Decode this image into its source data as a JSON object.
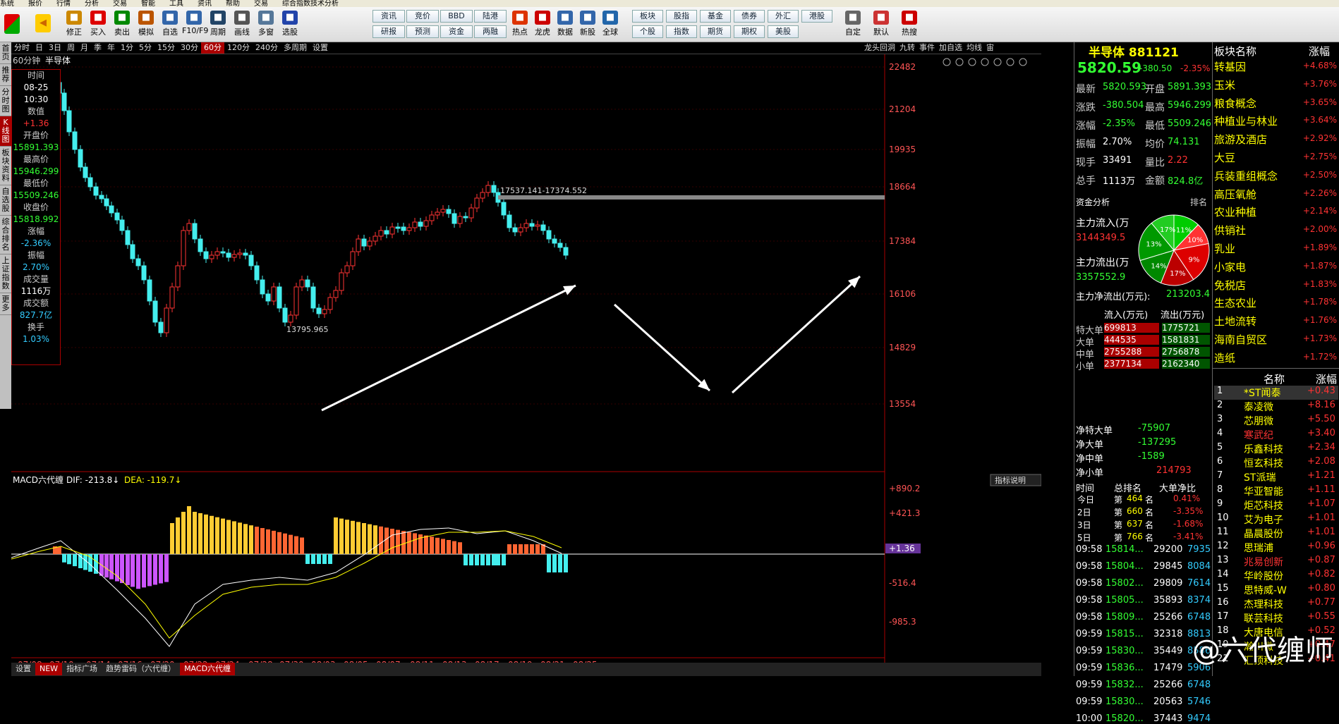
{
  "menu": [
    "系统",
    "报价",
    "行情",
    "分析",
    "交易",
    "智能",
    "工具",
    "资讯",
    "帮助",
    "交易",
    "综合指数技术分析"
  ],
  "toolbar": {
    "big": [
      {
        "label": "修正",
        "icon": "up-icon",
        "color": "#c80"
      },
      {
        "label": "买入",
        "icon": "buy-icon",
        "color": "#d00"
      },
      {
        "label": "卖出",
        "icon": "sell-icon",
        "color": "#080"
      },
      {
        "label": "模拟",
        "icon": "hammer-icon",
        "color": "#b50"
      },
      {
        "label": "自选",
        "icon": "star-icon",
        "color": "#36a"
      },
      {
        "label": "F10/F9",
        "icon": "f10-icon",
        "color": "#36a"
      },
      {
        "label": "周期",
        "icon": "clock-icon",
        "color": "#246"
      },
      {
        "label": "画线",
        "icon": "pencil-icon",
        "color": "#555"
      },
      {
        "label": "多窗",
        "icon": "window-icon",
        "color": "#579"
      },
      {
        "label": "选股",
        "icon": "search-icon",
        "color": "#24a"
      }
    ],
    "small_rows": [
      [
        "资讯",
        "竞价",
        "BBD",
        "陆港"
      ],
      [
        "研报",
        "预测",
        "资金",
        "两融"
      ]
    ],
    "mid": [
      {
        "label": "热点",
        "icon": "fire-icon",
        "color": "#d30"
      },
      {
        "label": "龙虎",
        "icon": "dragon-icon",
        "color": "#c00"
      },
      {
        "label": "数据",
        "icon": "pe-icon",
        "color": "#36a"
      },
      {
        "label": "新股",
        "icon": "doc-icon",
        "color": "#36a"
      },
      {
        "label": "全球",
        "icon": "globe-icon",
        "color": "#26a"
      }
    ],
    "small_rows2": [
      [
        "板块",
        "股指",
        "基金",
        "债券",
        "外汇",
        "港股"
      ],
      [
        "个股",
        "指数",
        "期货",
        "期权",
        "美股"
      ]
    ],
    "right": [
      {
        "label": "自定",
        "icon": "custom-icon",
        "color": "#666"
      },
      {
        "label": "默认",
        "icon": "home-icon",
        "color": "#c33"
      },
      {
        "label": "热搜",
        "icon": "hot-icon",
        "color": "#c00"
      }
    ]
  },
  "left_tabs": [
    "首页",
    "推荐",
    "分时图",
    "K线图",
    "板块资料",
    "自选股",
    "综合排名",
    "上证指数",
    "更多"
  ],
  "periods": [
    "分时",
    "日",
    "3日",
    "周",
    "月",
    "季",
    "年",
    "1分",
    "5分",
    "15分",
    "30分",
    "60分",
    "120分",
    "240分",
    "多周期",
    "设置"
  ],
  "period_selected": "60分",
  "right_tabs": [
    "龙头回洞",
    "九转",
    "事件",
    "加自选",
    "均线",
    "宙"
  ],
  "chart_label": "60分钟",
  "chart_name": "半导体",
  "info": [
    {
      "k": "时间",
      "v": "08-25"
    },
    {
      "k": "",
      "v": "10:30"
    },
    {
      "k": "数值",
      "v": "+1.36"
    },
    {
      "k": "开盘价",
      "v": "15891.393"
    },
    {
      "k": "最高价",
      "v": "15946.299"
    },
    {
      "k": "最低价",
      "v": "15509.246"
    },
    {
      "k": "收盘价",
      "v": "15818.992"
    },
    {
      "k": "涨幅",
      "v": "-2.36%"
    },
    {
      "k": "振幅",
      "v": "2.70%"
    },
    {
      "k": "成交量",
      "v": "1116万"
    },
    {
      "k": "成交额",
      "v": "827.7亿"
    },
    {
      "k": "换手",
      "v": "1.03%"
    }
  ],
  "price_axis": [
    "22482",
    "21204",
    "19935",
    "18664",
    "17384",
    "16106",
    "14829",
    "13554"
  ],
  "macd_axis": [
    "+890.2",
    "+421.3",
    "+1.36",
    "-516.4",
    "-985.3"
  ],
  "date_axis": [
    "07/08",
    "07/10",
    "07/14",
    "07/16",
    "07/20",
    "07/22",
    "07/24",
    "07/28",
    "07/30",
    "08/03",
    "08/05",
    "08/07",
    "08/11",
    "08/13",
    "08/17",
    "08/19",
    "08/21",
    "08/25"
  ],
  "annot_high": "17537.141-17374.552",
  "annot_low": "13795.965",
  "macd_label": "MACD六代缠",
  "macd_dif": "DIF: -213.8↓",
  "macd_dea": "DEA: -119.7↓",
  "indicator_btn": "指标说明",
  "status_tabs": [
    "设置",
    "NEW",
    "指标广场",
    "趋势雷码（六代缠）",
    "MACD六代缠"
  ],
  "quote": {
    "title": "半导体 881121",
    "price": "5820.59",
    "change": "-380.50",
    "pct": "-2.35%",
    "rows": [
      [
        "最新",
        "5820.593",
        "开盘",
        "5891.393"
      ],
      [
        "涨跌",
        "-380.504",
        "最高",
        "5946.299"
      ],
      [
        "涨幅",
        "-2.35%",
        "最低",
        "5509.246"
      ],
      [
        "振幅",
        "2.70%",
        "均价",
        "74.131"
      ],
      [
        "现手",
        "33491",
        "量比",
        "2.22"
      ],
      [
        "总手",
        "1113万",
        "金额",
        "824.8亿"
      ]
    ]
  },
  "fund": {
    "title": "资金分析",
    "rank": "排名",
    "inflow_label": "主力流入(万",
    "inflow": "3144349.5",
    "outflow_label": "主力流出(万",
    "outflow": "3357552.9",
    "net_label": "主力净流出(万元):",
    "net": "213203.4",
    "pie": [
      {
        "v": 11,
        "c": "#0c0"
      },
      {
        "v": 9,
        "c": "#f33"
      },
      {
        "v": 17,
        "c": "#d00"
      },
      {
        "v": 14,
        "c": "#b00"
      },
      {
        "v": 13,
        "c": "#080"
      },
      {
        "v": 17,
        "c": "#090"
      },
      {
        "v": 10,
        "c": "#2c2"
      }
    ],
    "pie_labels": [
      "11%",
      "10%",
      "9%",
      "17%",
      "14%",
      "13%",
      "17%",
      "10%"
    ],
    "flow_head": [
      "流入(万元)",
      "流出(万元)"
    ],
    "flows": [
      [
        "特大单",
        "699813",
        "1775721"
      ],
      [
        "大单",
        "444535",
        "1581831"
      ],
      [
        "中单",
        "2755288",
        "2756878"
      ],
      [
        "小单",
        "2377134",
        "2162340"
      ]
    ],
    "nets": [
      [
        "净特大单",
        "-75907"
      ],
      [
        "净大单",
        "-137295"
      ],
      [
        "净中单",
        "-1589"
      ],
      [
        "净小单",
        "214793"
      ]
    ],
    "rank_head": [
      "时间",
      "总排名",
      "大单净比"
    ],
    "ranks": [
      [
        "今日",
        "第",
        "464",
        "名",
        "0.41%"
      ],
      [
        "2日",
        "第",
        "660",
        "名",
        "-3.35%"
      ],
      [
        "3日",
        "第",
        "637",
        "名",
        "-1.68%"
      ],
      [
        "5日",
        "第",
        "766",
        "名",
        "-3.41%"
      ]
    ],
    "ticks": [
      [
        "09:58",
        "15814...",
        "29200",
        "7935"
      ],
      [
        "09:58",
        "15804...",
        "29845",
        "8084"
      ],
      [
        "09:58",
        "15802...",
        "29809",
        "7614"
      ],
      [
        "09:58",
        "15805...",
        "35893",
        "8374"
      ],
      [
        "09:58",
        "15809...",
        "25266",
        "6748"
      ],
      [
        "09:59",
        "15815...",
        "32318",
        "8813"
      ],
      [
        "09:59",
        "15830...",
        "35449",
        "8586"
      ],
      [
        "09:59",
        "15836...",
        "17479",
        "5906"
      ],
      [
        "09:59",
        "15832...",
        "25266",
        "6748"
      ],
      [
        "09:59",
        "15830...",
        "20563",
        "5746"
      ],
      [
        "10:00",
        "15820...",
        "37443",
        "9474"
      ]
    ]
  },
  "sector_head": [
    "板块名称",
    "涨幅"
  ],
  "sectors": [
    [
      "转基因",
      "+4.68%"
    ],
    [
      "玉米",
      "+3.76%"
    ],
    [
      "粮食概念",
      "+3.65%"
    ],
    [
      "种植业与林业",
      "+3.64%"
    ],
    [
      "旅游及酒店",
      "+2.92%"
    ],
    [
      "大豆",
      "+2.75%"
    ],
    [
      "兵装重组概念",
      "+2.50%"
    ],
    [
      "高压氧舱",
      "+2.26%"
    ],
    [
      "农业种植",
      "+2.14%"
    ],
    [
      "供销社",
      "+2.00%"
    ],
    [
      "乳业",
      "+1.89%"
    ],
    [
      "小家电",
      "+1.87%"
    ],
    [
      "免税店",
      "+1.83%"
    ],
    [
      "生态农业",
      "+1.78%"
    ],
    [
      "土地流转",
      "+1.76%"
    ],
    [
      "海南自贸区",
      "+1.73%"
    ],
    [
      "造纸",
      "+1.72%"
    ]
  ],
  "stocks_head": [
    "名称",
    "涨幅"
  ],
  "stocks": [
    [
      "1",
      "*ST闻泰",
      "+0.43"
    ],
    [
      "2",
      "泰凌微",
      "+8.16"
    ],
    [
      "3",
      "芯朋微",
      "+5.50"
    ],
    [
      "4",
      "寒武纪",
      "+3.40"
    ],
    [
      "5",
      "乐鑫科技",
      "+2.34"
    ],
    [
      "6",
      "恒玄科技",
      "+2.08"
    ],
    [
      "7",
      "ST派瑞",
      "+1.21"
    ],
    [
      "8",
      "华亚智能",
      "+1.11"
    ],
    [
      "9",
      "炬芯科技",
      "+1.07"
    ],
    [
      "10",
      "艾为电子",
      "+1.01"
    ],
    [
      "11",
      "晶晨股份",
      "+1.01"
    ],
    [
      "12",
      "思瑞浦",
      "+0.96"
    ],
    [
      "13",
      "兆易创新",
      "+0.87"
    ],
    [
      "14",
      "华岭股份",
      "+0.82"
    ],
    [
      "15",
      "思特威-W",
      "+0.80"
    ],
    [
      "16",
      "杰理科技",
      "+0.77"
    ],
    [
      "17",
      "联芸科技",
      "+0.55"
    ],
    [
      "18",
      "大唐电信",
      "+0.52"
    ],
    [
      "19",
      "瀚川微",
      "+0.47"
    ],
    [
      "21",
      "汇顶科技",
      "+0.41"
    ]
  ],
  "watermark": "@六代缠师"
}
